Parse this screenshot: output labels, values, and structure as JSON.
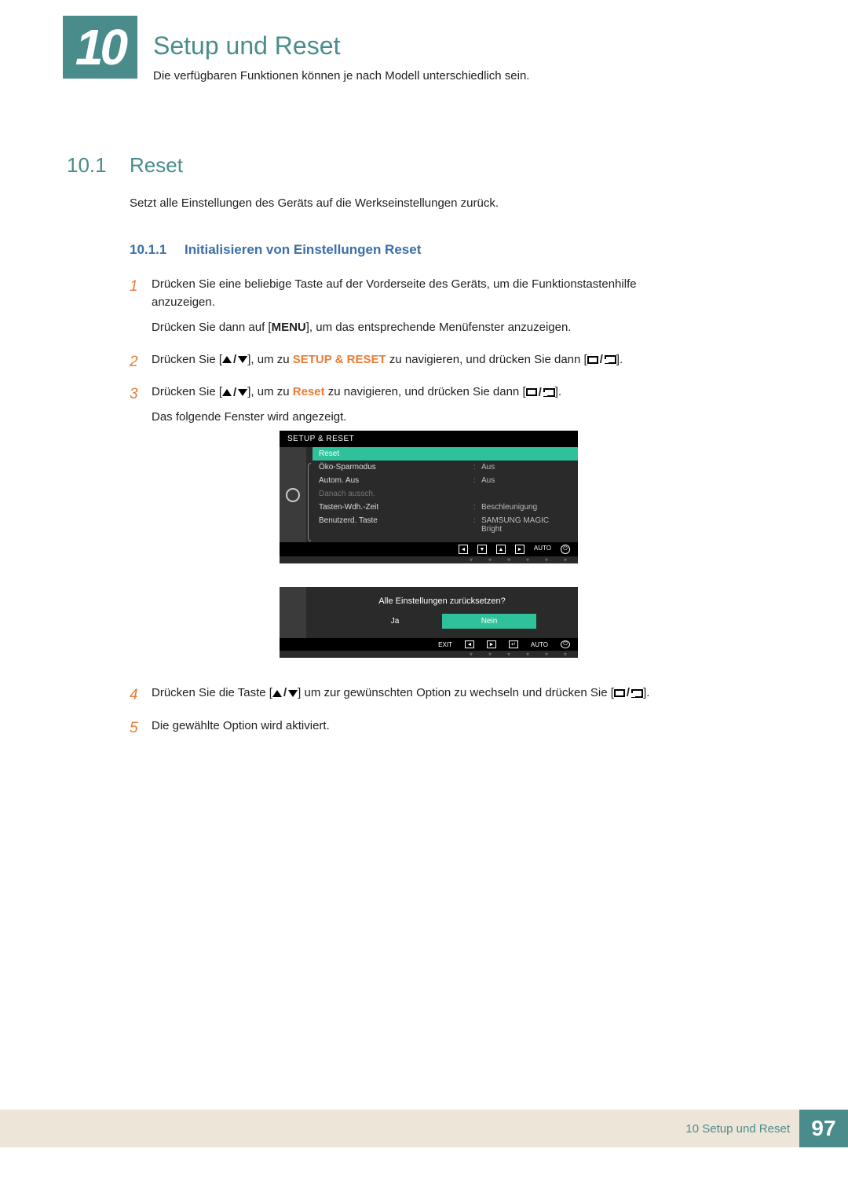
{
  "chapter": {
    "number": "10",
    "title": "Setup und Reset",
    "subtitle": "Die verfügbaren Funktionen können je nach Modell unterschiedlich sein."
  },
  "section": {
    "number": "10.1",
    "title": "Reset",
    "desc": "Setzt alle Einstellungen des Geräts auf die Werkseinstellungen zurück."
  },
  "subsection": {
    "number": "10.1.1",
    "title": "Initialisieren von Einstellungen Reset"
  },
  "steps": {
    "s1a": "Drücken Sie eine beliebige Taste auf der Vorderseite des Geräts, um die Funktionstastenhilfe anzuzeigen.",
    "s1b_pre": "Drücken Sie dann auf [",
    "s1b_menu": "MENU",
    "s1b_post": "], um das entsprechende Menüfenster anzuzeigen.",
    "s2_pre": "Drücken Sie [",
    "s2_mid": "], um zu ",
    "s2_accent": "SETUP & RESET",
    "s2_post": " zu navigieren, und drücken Sie dann [",
    "s2_end": "].",
    "s3_pre": "Drücken Sie [",
    "s3_mid": "], um zu ",
    "s3_accent": "Reset",
    "s3_post": " zu navigieren, und drücken Sie dann [",
    "s3_end": "].",
    "s3_b": "Das folgende Fenster wird angezeigt.",
    "s4_pre": "Drücken Sie die Taste [",
    "s4_mid": "] um zur gewünschten Option zu wechseln und drücken Sie [",
    "s4_end": "].",
    "s5": "Die gewählte Option wird aktiviert."
  },
  "step_numbers": {
    "n1": "1",
    "n2": "2",
    "n3": "3",
    "n4": "4",
    "n5": "5"
  },
  "osd1": {
    "title": "SETUP & RESET",
    "items": [
      {
        "label": "Reset",
        "value": "",
        "hl": true,
        "dim": false
      },
      {
        "label": "Öko-Sparmodus",
        "value": "Aus",
        "hl": false,
        "dim": false
      },
      {
        "label": "Autom. Aus",
        "value": "Aus",
        "hl": false,
        "dim": false
      },
      {
        "label": "Danach aussch.",
        "value": "",
        "hl": false,
        "dim": true
      },
      {
        "label": "Tasten-Wdh.-Zeit",
        "value": "Beschleunigung",
        "hl": false,
        "dim": false
      },
      {
        "label": "Benutzerd. Taste",
        "value": "SAMSUNG MAGIC Bright",
        "hl": false,
        "dim": false
      }
    ],
    "ctrl_auto": "AUTO"
  },
  "osd2": {
    "question": "Alle Einstellungen zurücksetzen?",
    "yes": "Ja",
    "no": "Nein",
    "exit": "EXIT",
    "auto": "AUTO"
  },
  "footer": {
    "text": "10 Setup und Reset",
    "page": "97"
  }
}
